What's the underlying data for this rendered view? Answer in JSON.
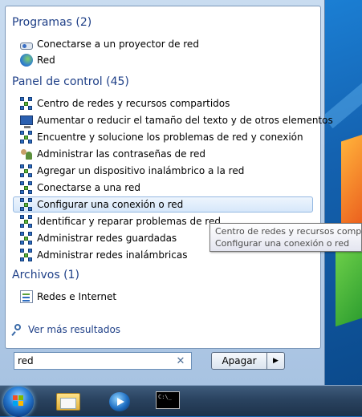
{
  "sections": {
    "programs": {
      "heading": "Programas (2)",
      "items": [
        {
          "label": "Conectarse a un proyector de red",
          "icon": "projector-icon"
        },
        {
          "label": "Red",
          "icon": "network-globe-icon"
        }
      ]
    },
    "control_panel": {
      "heading": "Panel de control (45)",
      "items": [
        {
          "label": "Centro de redes y recursos compartidos",
          "icon": "network-icon"
        },
        {
          "label": "Aumentar o reducir el tamaño del texto y de otros elementos",
          "icon": "display-icon"
        },
        {
          "label": "Encuentre y solucione los problemas de red y conexión",
          "icon": "network-icon"
        },
        {
          "label": "Administrar las contraseñas de red",
          "icon": "users-icon"
        },
        {
          "label": "Agregar un dispositivo inalámbrico a la red",
          "icon": "network-icon"
        },
        {
          "label": "Conectarse a una red",
          "icon": "network-icon"
        },
        {
          "label": "Configurar una conexión o red",
          "icon": "network-icon",
          "selected": true
        },
        {
          "label": "Identificar y reparar problemas de red",
          "icon": "network-icon"
        },
        {
          "label": "Administrar redes guardadas",
          "icon": "network-icon"
        },
        {
          "label": "Administrar redes inalámbricas",
          "icon": "network-icon"
        }
      ]
    },
    "files": {
      "heading": "Archivos (1)",
      "items": [
        {
          "label": "Redes e Internet",
          "icon": "document-icon"
        }
      ]
    }
  },
  "more_results": "Ver más resultados",
  "search": {
    "value": "red",
    "clear_glyph": "✕"
  },
  "shutdown": {
    "label": "Apagar",
    "arrow": "▶"
  },
  "tooltip": {
    "line1": "Centro de redes y recursos compar",
    "line2": "Configurar una conexión o red"
  },
  "taskbar": {
    "cmd_text": "C:\\_"
  }
}
